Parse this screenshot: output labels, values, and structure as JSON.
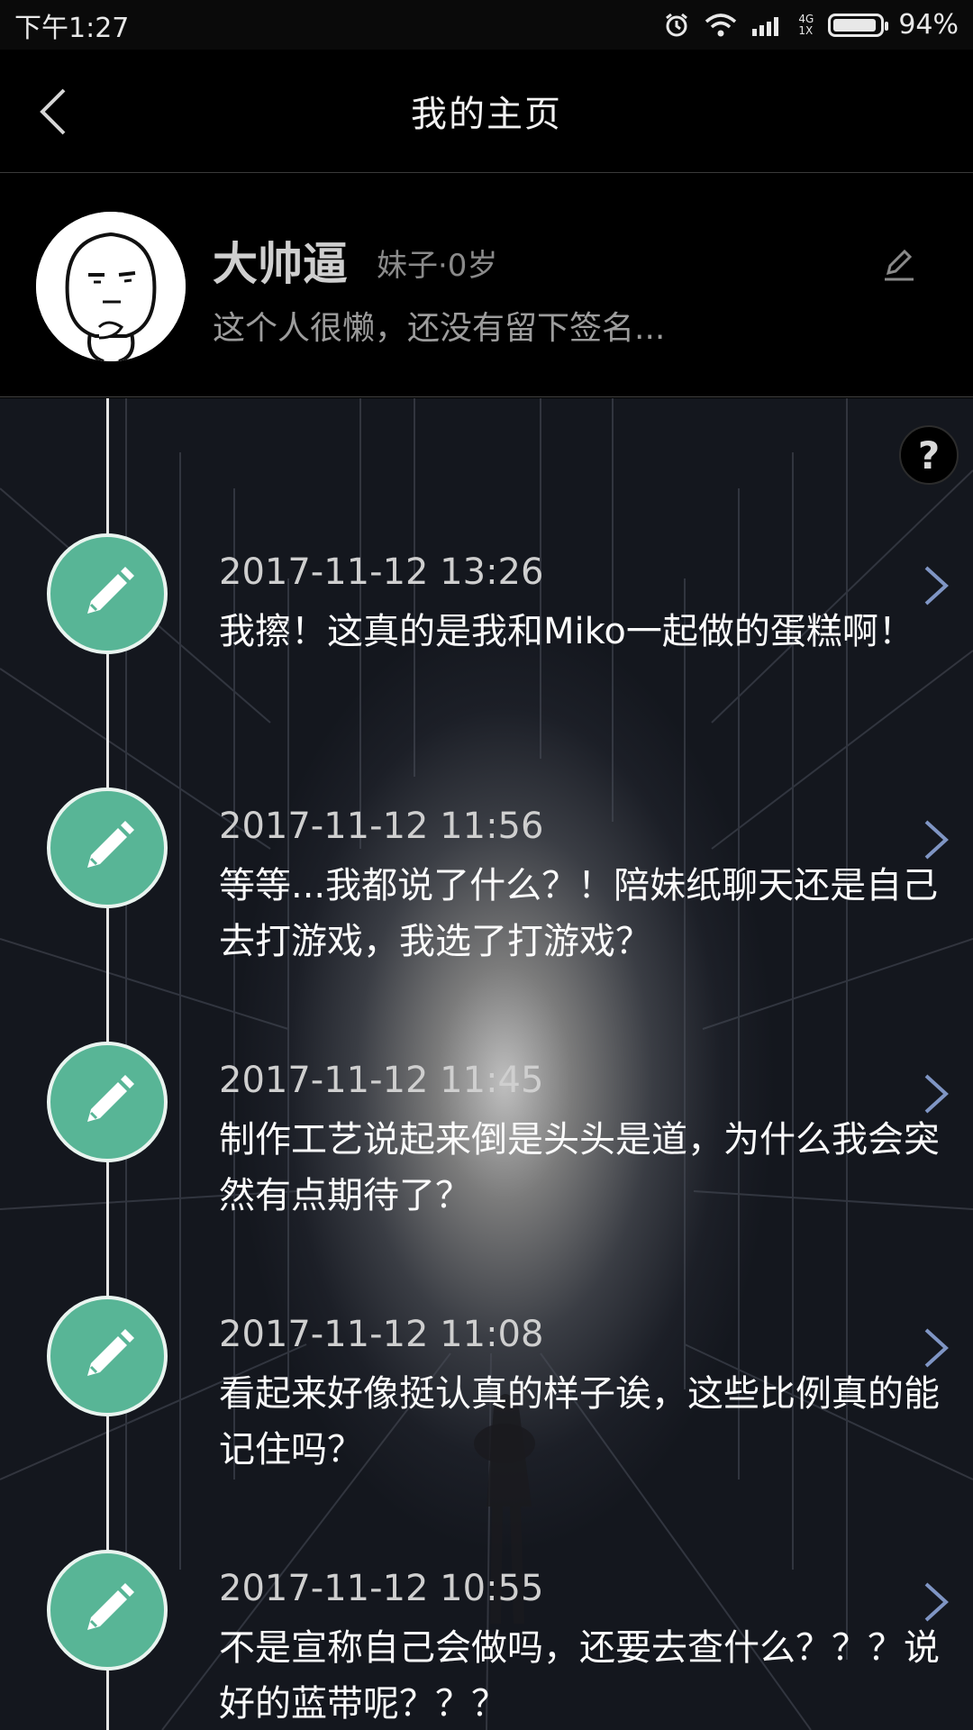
{
  "status_bar": {
    "time": "下午1:27",
    "network_top": "4G",
    "network_bottom": "1X",
    "battery": "94%",
    "battery_level": 0.94,
    "icons": [
      "alarm-icon",
      "wifi-icon",
      "signal-icon",
      "battery-icon"
    ]
  },
  "nav": {
    "title": "我的主页",
    "back_icon": "chevron-left-icon"
  },
  "profile": {
    "name": "大帅逼",
    "meta": "妹子·0岁",
    "signature": "这个人很懒，还没有留下签名...",
    "edit_icon": "pencil-outline-icon"
  },
  "help": {
    "label": "?"
  },
  "colors": {
    "accent_green": "#58b596",
    "background": "#000000"
  },
  "entries": [
    {
      "time": "2017-11-12 13:26",
      "text": "我擦！这真的是我和Miko一起做的蛋糕啊！"
    },
    {
      "time": "2017-11-12 11:56",
      "text": "等等...我都说了什么？！陪妹纸聊天还是自己去打游戏，我选了打游戏？"
    },
    {
      "time": "2017-11-12 11:45",
      "text": "制作工艺说起来倒是头头是道，为什么我会突然有点期待了？"
    },
    {
      "time": "2017-11-12 11:08",
      "text": "看起来好像挺认真的样子诶，这些比例真的能记住吗？"
    },
    {
      "time": "2017-11-12 10:55",
      "text": "不是宣称自己会做吗，还要去查什么？？？说好的蓝带呢？？？"
    }
  ]
}
